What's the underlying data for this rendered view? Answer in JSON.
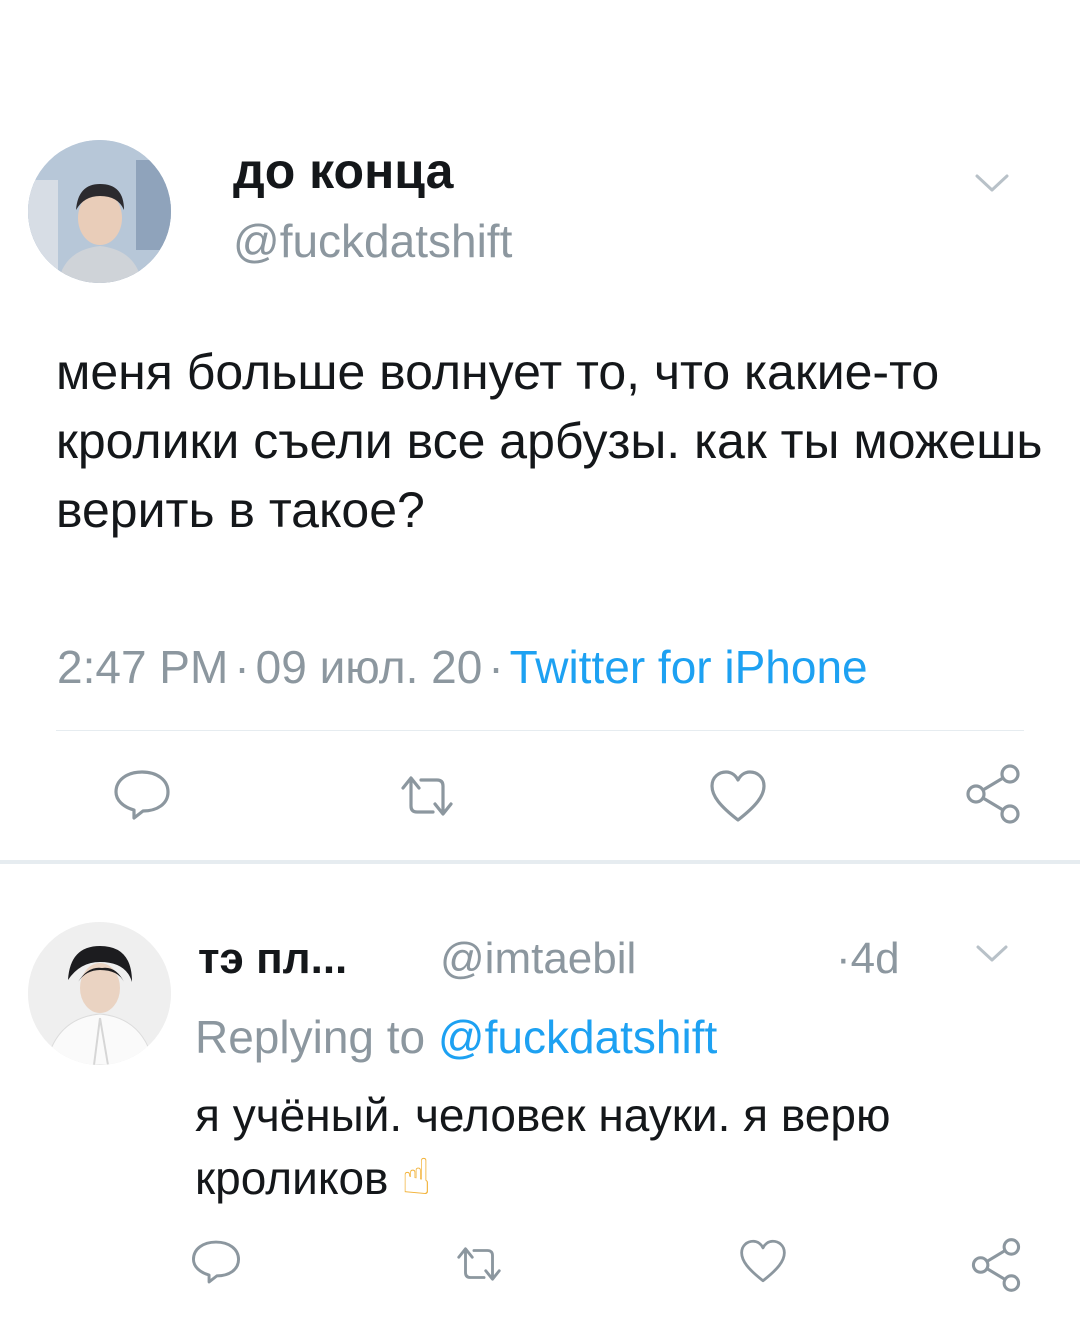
{
  "tweet": {
    "display_name": "до конца",
    "handle": "@fuckdatshift",
    "text": "меня больше волнует то, что какие-то кролики съели все арбузы. как ты можешь верить в такое?",
    "time": "2:47 PM",
    "date": "09 июл. 20",
    "source": "Twitter for iPhone",
    "dot": "·"
  },
  "reply": {
    "display_name": "тэ пл...",
    "handle": "@imtaebil",
    "time_dot": "·",
    "time": "4d",
    "replying_prefix": "Replying to",
    "replying_handle": "@fuckdatshift",
    "text": "я учёный. человек науки. я верю кроликов",
    "emoji": "☝"
  },
  "icons": [
    "reply-icon",
    "retweet-icon",
    "like-icon",
    "share-icon",
    "chevron-down-icon"
  ],
  "colors": {
    "link": "#1da1f2",
    "secondary_text": "#8c979f",
    "icon": "#8c979f",
    "divider": "#e6ecf0"
  }
}
